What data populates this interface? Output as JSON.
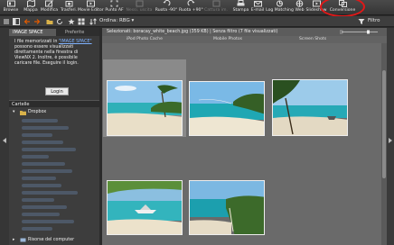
{
  "toolbar": {
    "items": [
      {
        "label": "Browse",
        "icon": "browse-icon"
      },
      {
        "label": "Mappa",
        "icon": "map-icon"
      },
      {
        "label": "Modifica",
        "icon": "edit-icon"
      },
      {
        "label": "Trasferi.",
        "icon": "transfer-icon"
      },
      {
        "label": "Movie Editor",
        "icon": "movie-editor-icon"
      },
      {
        "label": "Punto AF",
        "icon": "af-point-icon"
      },
      {
        "label": "Nessi. uscita",
        "icon": "no-output-icon",
        "disabled": true
      },
      {
        "label": "Ruota -90°",
        "icon": "rotate-left-icon"
      },
      {
        "label": "Ruota +90°",
        "icon": "rotate-right-icon"
      },
      {
        "label": "Cattura im.",
        "icon": "capture-icon",
        "disabled": true
      },
      {
        "label": "Stampa",
        "icon": "print-icon"
      },
      {
        "label": "E-mail",
        "icon": "email-icon"
      },
      {
        "label": "Log Matching",
        "icon": "log-matching-icon"
      },
      {
        "label": "Web",
        "icon": "web-icon"
      },
      {
        "label": "Slideshow",
        "icon": "slideshow-icon"
      },
      {
        "label": "Conversione",
        "icon": "conversion-icon"
      }
    ]
  },
  "subbar": {
    "order_label": "Ordina: RBG ▾",
    "filter_label": "Filtro"
  },
  "left_panel": {
    "tab_active": "IMAGE SPACE",
    "tab_other": "Preferite",
    "message_prefix": "I file memorizzati in ",
    "message_link": "\"IMAGE SPACE\"",
    "message_rest": " possono essere visualizzati direttamente nella finestra di ViewNX 2. Inoltre, è possibile caricare file. Eseguire il login.",
    "login_label": "Login",
    "folders_label": "Cartelle",
    "dropbox_label": "Dropbox",
    "computer_label": "Risorse del computer"
  },
  "main": {
    "status_text": "Selezionati: boracay_white_beach.jpg (359 KB) | Senza filtro (7 file visualizzati)",
    "column_headers": [
      "iPod Photo Cache",
      "Mobile Photos",
      "Screen Shots"
    ]
  },
  "colors": {
    "highlight": "#e01818",
    "link": "#7fb2ff"
  }
}
